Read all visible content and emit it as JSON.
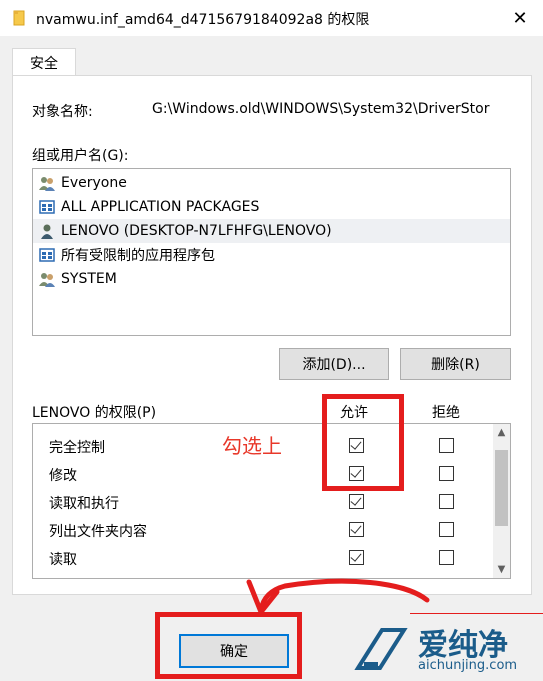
{
  "window": {
    "title": "nvamwu.inf_amd64_d4715679184092a8 的权限",
    "close_glyph": "✕"
  },
  "tabs": [
    {
      "label": "安全",
      "active": true
    }
  ],
  "object": {
    "label": "对象名称:",
    "value": "G:\\Windows.old\\WINDOWS\\System32\\DriverStor"
  },
  "groups": {
    "label": "组或用户名(G):",
    "items": [
      {
        "name": "Everyone",
        "icon": "users-icon"
      },
      {
        "name": "ALL APPLICATION PACKAGES",
        "icon": "package-icon"
      },
      {
        "name": "LENOVO (DESKTOP-N7LFHFG\\LENOVO)",
        "icon": "user-icon",
        "selected": true
      },
      {
        "name": "所有受限制的应用程序包",
        "icon": "package-icon"
      },
      {
        "name": "SYSTEM",
        "icon": "users-icon"
      }
    ],
    "add_button": "添加(D)...",
    "remove_button": "删除(R)"
  },
  "permissions": {
    "label": "LENOVO 的权限(P)",
    "allow_header": "允许",
    "deny_header": "拒绝",
    "rows": [
      {
        "name": "完全控制",
        "allow": true,
        "deny": false
      },
      {
        "name": "修改",
        "allow": true,
        "deny": false
      },
      {
        "name": "读取和执行",
        "allow": true,
        "deny": false
      },
      {
        "name": "列出文件夹内容",
        "allow": true,
        "deny": false
      },
      {
        "name": "读取",
        "allow": true,
        "deny": false
      }
    ]
  },
  "annotation": {
    "text": "勾选上",
    "color": "#e8382a"
  },
  "footer": {
    "ok_button": "确定"
  },
  "watermark": {
    "brand": "爱纯净",
    "site": "aichunjing.com"
  }
}
